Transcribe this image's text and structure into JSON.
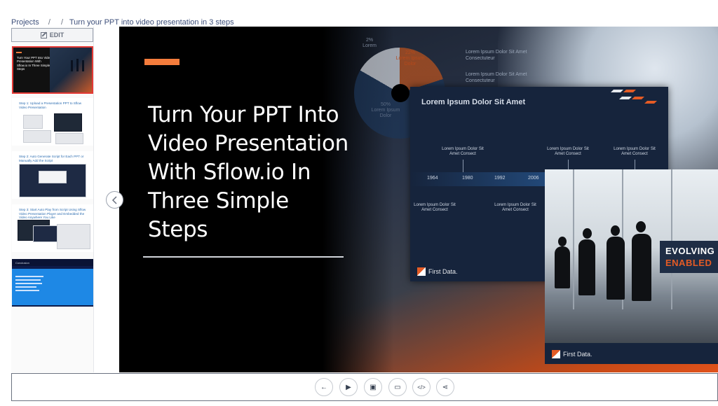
{
  "breadcrumb": {
    "root": "Projects",
    "sep1": "/",
    "sep2": "/",
    "current": "Turn your PPT into video presentation in 3 steps"
  },
  "sidebar": {
    "edit_label": "EDIT",
    "thumbnails": [
      {
        "text": "Turn Your PPT Into Video Presentation With Sflow.io In Three Simple Steps",
        "active": true
      },
      {
        "text": "Step 1: Upload a Presentation PPT to Sflow Video Presentation"
      },
      {
        "text": "Step 2: Auto Generate Script for Each PPT or Manually Add the Script"
      },
      {
        "text": "Step 3: Start Auto Play from Script Using Sflow Video Presentation Player and Embedded the Video Anywhere You Like"
      },
      {
        "text": "Conclusion"
      }
    ]
  },
  "slide": {
    "headline": "Turn Your PPT Into Video Presentation With Sflow.io In Three Simple Steps",
    "accent_color": "#f47c3c",
    "background": {
      "pie": {
        "top_label": "2%",
        "top_sub": "Lorem",
        "orange_label": "22%",
        "orange_sub": "Lorem Ipsum Dolor",
        "blue_label": "50%",
        "blue_sub": "Lorem Ipsum Dolor"
      },
      "side_notes": [
        "Lorem Ipsum Dolor Sit Amet Consectuteur",
        "Lorem Ipsum Dolor Sit Amet Consectuteur"
      ],
      "card": {
        "title": "Lorem Ipsum Dolor Sit Amet",
        "labels_top": [
          "Lorem Ipsum Dolor Sit Amet Consect",
          "Lorem Ipsum Dolor Sit Amet Consect",
          "Lorem Ipsum Dolor Sit Amet Consect"
        ],
        "years": [
          "1964",
          "1980",
          "1992",
          "2006"
        ],
        "labels_bottom": [
          "Lorem Ipsum Dolor Sit Amet Consect",
          "Lorem Ipsum Dolor Sit Amet Consect"
        ],
        "brand": "First Data."
      },
      "photo": {
        "badge_line1": "EVOLVING",
        "badge_line2": "ENABLED",
        "brand": "First Data."
      }
    }
  },
  "toolbar": {
    "buttons": [
      {
        "name": "back-button",
        "icon": "arrow-left-icon",
        "glyph": "←"
      },
      {
        "name": "play-button",
        "icon": "play-icon",
        "glyph": "▶"
      },
      {
        "name": "image-button",
        "icon": "image-icon",
        "glyph": "▣"
      },
      {
        "name": "video-button",
        "icon": "video-camera-icon",
        "glyph": "▭"
      },
      {
        "name": "embed-code-button",
        "icon": "code-icon",
        "glyph": "</>"
      },
      {
        "name": "share-button",
        "icon": "share-icon",
        "glyph": "⋖"
      }
    ]
  }
}
